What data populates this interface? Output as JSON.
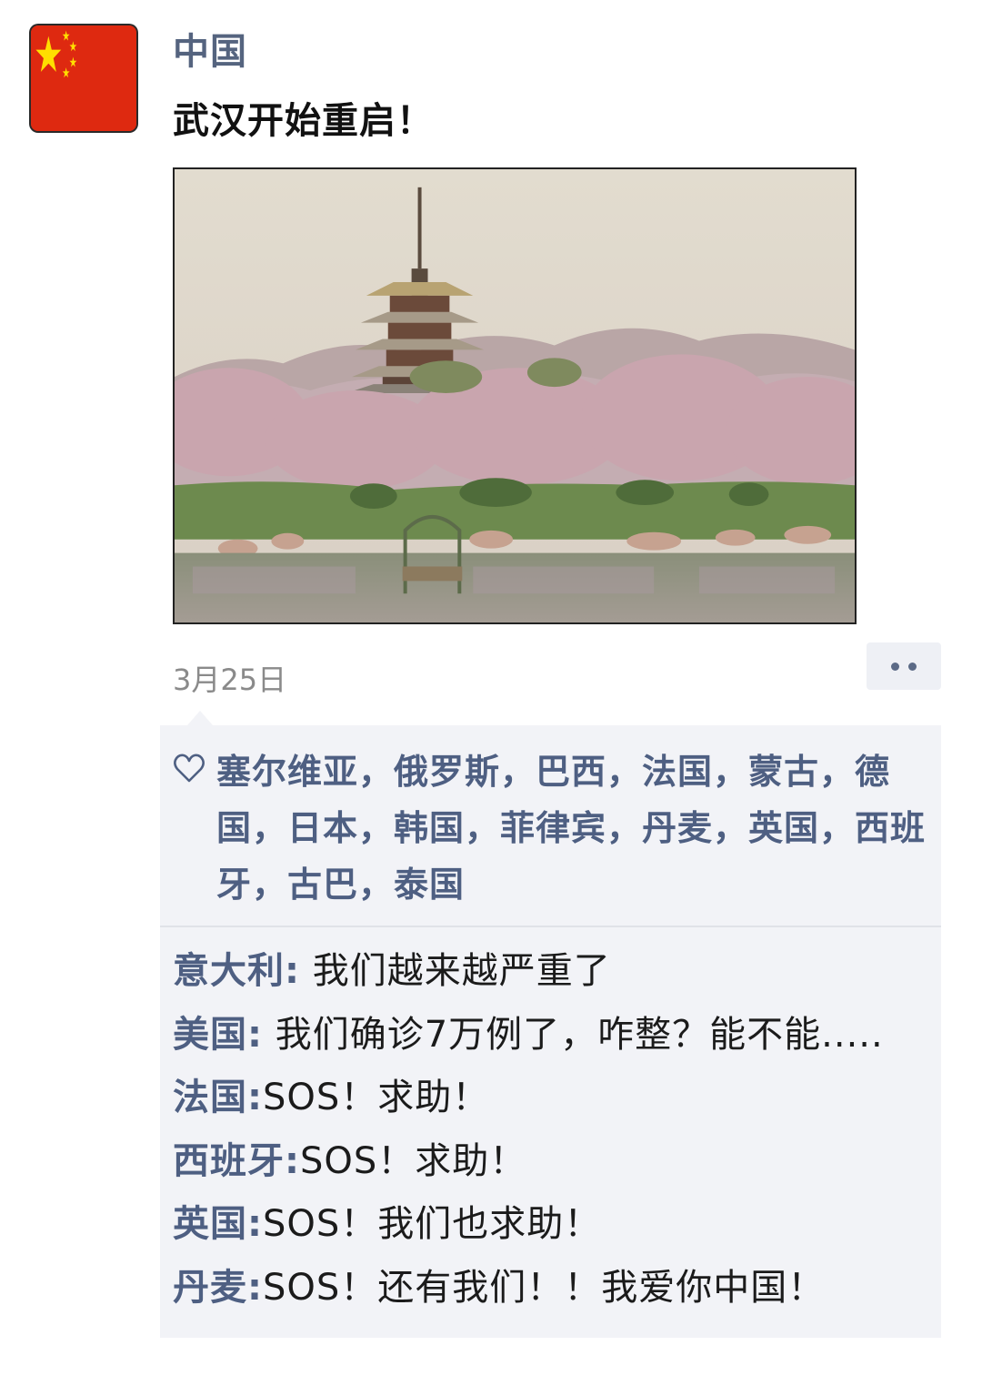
{
  "post": {
    "author": "中国",
    "text": "武汉开始重启！",
    "date": "3月25日",
    "colors": {
      "name": "#55647f",
      "panel_bg": "#f2f3f7",
      "flag_red": "#de2910",
      "flag_yellow": "#ffde00"
    }
  },
  "avatar": {
    "icon": "china-flag-icon"
  },
  "image": {
    "icon": "pagoda-cherry-blossom-photo"
  },
  "more_button": {
    "icon": "more-dots-icon"
  },
  "likes": {
    "icon": "heart-outline-icon",
    "names": "塞尔维亚，俄罗斯，巴西，法国，蒙古，德国，日本，韩国，菲律宾，丹麦，英国，西班牙，古巴，泰国"
  },
  "comments": [
    {
      "user": "意大利:",
      "text": "  我们越来越严重了"
    },
    {
      "user": "美国:",
      "text": "  我们确诊7万例了，咋整？能不能....."
    },
    {
      "user": "法国:",
      "text": "SOS！求助！"
    },
    {
      "user": "西班牙:",
      "text": "SOS！求助！"
    },
    {
      "user": "英国:",
      "text": "SOS！我们也求助！"
    },
    {
      "user": "丹麦:",
      "text": "SOS！还有我们！！我爱你中国！"
    }
  ]
}
